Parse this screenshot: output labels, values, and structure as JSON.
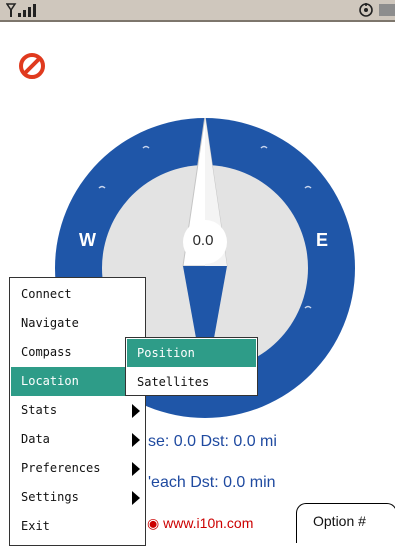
{
  "colors": {
    "compass_ring": "#1f56a8",
    "compass_face": "#e3e3e3",
    "menu_highlight": "#2e9c88",
    "info_text": "#1f4aa0",
    "url_text": "#cc0000"
  },
  "status_bar": {
    "signal_icon": "signal-strength-icon",
    "sync_icon": "sync-icon",
    "battery_icon": "battery-icon"
  },
  "compass": {
    "west_label": "W",
    "east_label": "E",
    "heading_value": "0.0"
  },
  "info": {
    "speed_line": "se: 0.0  Dst: 0.0 mi",
    "reach_line": "'each Dst: 0.0 min",
    "url": "www.i10n.com"
  },
  "option_tab": {
    "label": "Option #"
  },
  "menu": {
    "items": [
      {
        "label": "Connect",
        "has_submenu": false
      },
      {
        "label": "Navigate",
        "has_submenu": false
      },
      {
        "label": "Compass",
        "has_submenu": false
      },
      {
        "label": "Location",
        "has_submenu": false
      },
      {
        "label": "Stats",
        "has_submenu": true
      },
      {
        "label": "Data",
        "has_submenu": true
      },
      {
        "label": "Preferences",
        "has_submenu": true
      },
      {
        "label": "Settings",
        "has_submenu": true
      },
      {
        "label": "Exit",
        "has_submenu": false
      }
    ],
    "active_index": 3
  },
  "submenu": {
    "items": [
      {
        "label": "Position"
      },
      {
        "label": "Satellites"
      }
    ],
    "active_index": 0
  }
}
